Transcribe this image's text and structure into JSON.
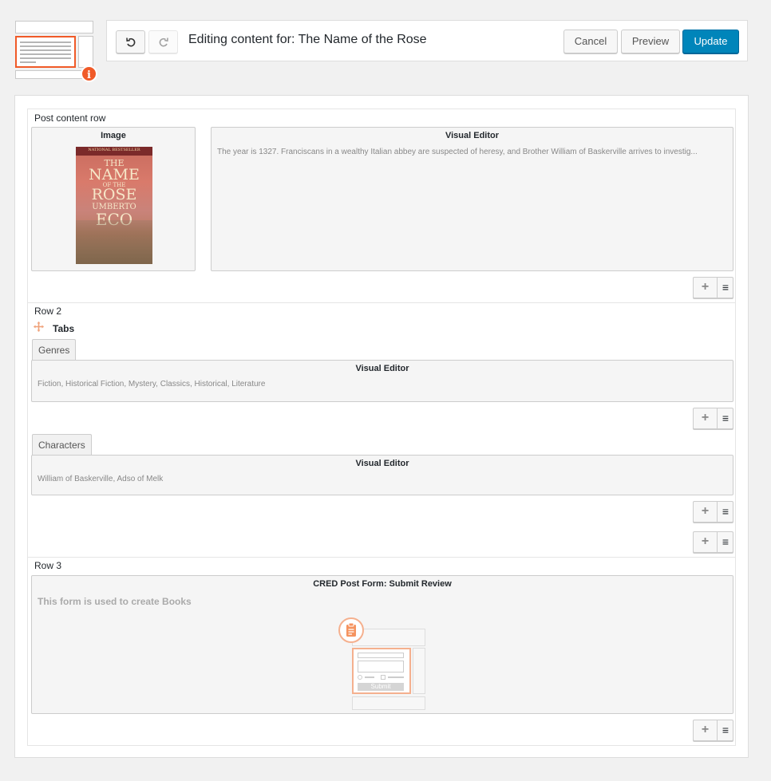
{
  "header": {
    "title": "Editing content for: The Name of the Rose",
    "cancel_label": "Cancel",
    "preview_label": "Preview",
    "update_label": "Update",
    "accent_color": "#0085ba",
    "logo_color": "#f05a28"
  },
  "rows": [
    {
      "label": "Post content row",
      "cells": [
        {
          "title": "Image",
          "cover": {
            "top_line": "NATIONAL BESTSELLER",
            "title_line1": "THE",
            "title_line2": "NAME",
            "title_line3": "OF THE",
            "title_line4": "ROSE",
            "author1": "UMBERTO",
            "author2": "ECO"
          }
        },
        {
          "title": "Visual Editor",
          "text": "The year is 1327. Franciscans in a wealthy Italian abbey are suspected of heresy, and Brother William of Baskerville arrives to investig..."
        }
      ]
    },
    {
      "label": "Row 2",
      "tabs_title": "Tabs",
      "tabs": [
        {
          "label": "Genres",
          "cell_title": "Visual Editor",
          "text": "Fiction, Historical Fiction, Mystery, Classics, Historical, Literature"
        },
        {
          "label": "Characters",
          "cell_title": "Visual Editor",
          "text": "William of Baskerville, Adso of Melk"
        }
      ]
    },
    {
      "label": "Row 3",
      "cell_title": "CRED Post Form: Submit Review",
      "form_description": "This form is used to create Books",
      "submit_label": "Submit"
    }
  ],
  "icons": {
    "undo": "undo-icon",
    "redo": "redo-icon",
    "plus": "plus-icon",
    "menu": "hamburger-menu-icon",
    "move": "move-arrows-icon",
    "info": "info-icon"
  }
}
